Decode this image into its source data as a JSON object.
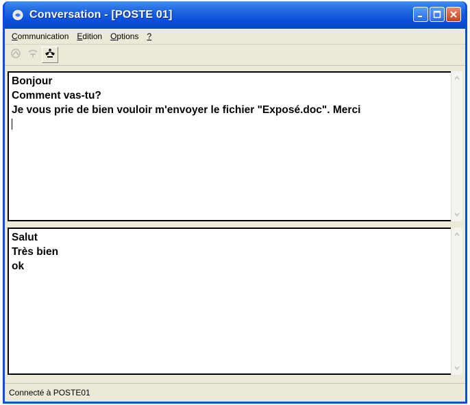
{
  "window": {
    "title": "Conversation - [POSTE 01]",
    "app_icon": "chat-icon",
    "caption_buttons": [
      "minimize-icon",
      "maximize-icon",
      "close-icon"
    ]
  },
  "menubar": {
    "items": [
      {
        "accel": "C",
        "rest": "ommunication"
      },
      {
        "accel": "E",
        "rest": "dition"
      },
      {
        "accel": "O",
        "rest": "ptions"
      },
      {
        "accel": "?",
        "rest": ""
      }
    ]
  },
  "toolbar": {
    "buttons": [
      {
        "icon": "connect-icon",
        "enabled": false
      },
      {
        "icon": "disconnect-icon",
        "enabled": false
      },
      {
        "icon": "hangup-icon",
        "enabled": true
      }
    ]
  },
  "send_pane": {
    "lines": [
      "Bonjour",
      "Comment vas-tu?",
      "Je vous prie de bien vouloir m'envoyer le fichier \"Exposé.doc\". Merci"
    ]
  },
  "receive_pane": {
    "lines": [
      "Salut",
      "Très bien",
      "ok"
    ]
  },
  "statusbar": {
    "text": "Connecté à POSTE01"
  },
  "colors": {
    "titlebar": "#0a4fd8",
    "client": "#ece9d8",
    "close_button": "#c8401f"
  }
}
